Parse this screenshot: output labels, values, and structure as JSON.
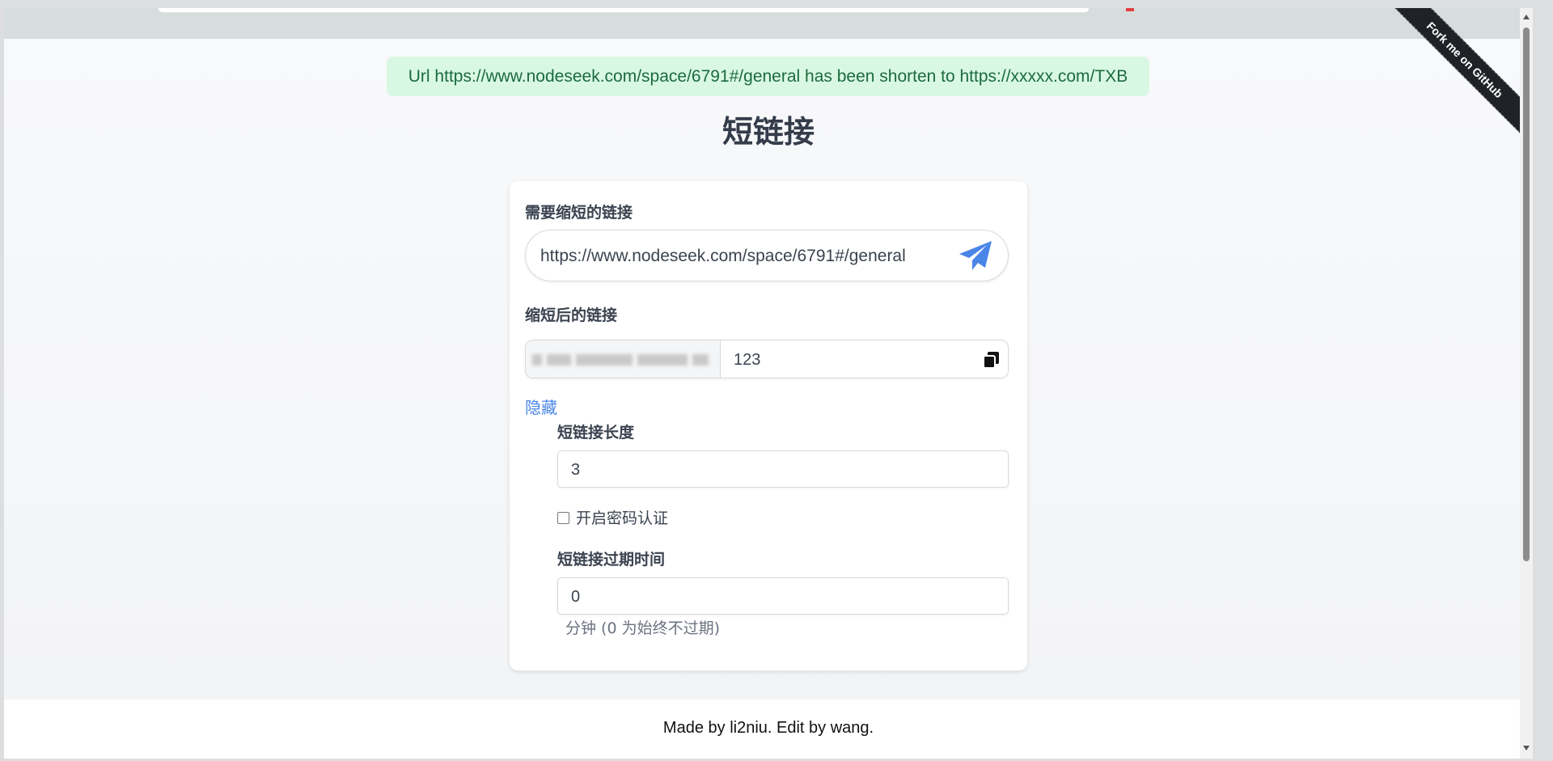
{
  "alert": {
    "message": "Url https://www.nodeseek.com/space/6791#/general has been shorten to https://xxxxx.com/TXB"
  },
  "title": "短链接",
  "form": {
    "long_url_label": "需要缩短的链接",
    "long_url_value": "https://www.nodeseek.com/space/6791#/general",
    "send_icon": "paper-plane-icon",
    "short_url_label": "缩短后的链接",
    "short_code_value": "123",
    "copy_icon": "copy-icon",
    "toggle_link": "隐藏",
    "length_label": "短链接长度",
    "length_value": "3",
    "password_label": "开启密码认证",
    "password_checked": false,
    "expire_label": "短链接过期时间",
    "expire_value": "0",
    "expire_hint": "分钟 (0 为始终不过期)"
  },
  "ribbon": {
    "text": "Fork me on GitHub"
  },
  "footer": {
    "text": "Made by li2niu. Edit by wang."
  },
  "colors": {
    "accent": "#4a86e8",
    "alert_bg": "#d9f8e4",
    "alert_text": "#1b6b3e",
    "ribbon_bg": "#1f2328"
  }
}
